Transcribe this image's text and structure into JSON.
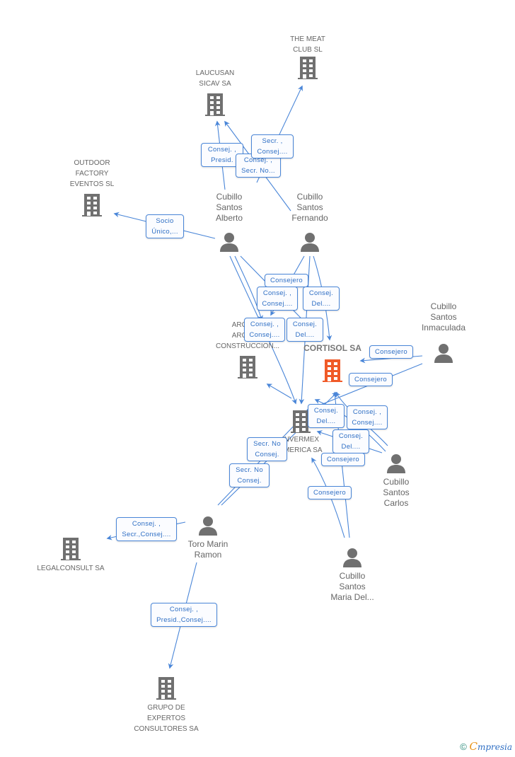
{
  "diagram": {
    "type": "corporate-relationship-graph",
    "colors": {
      "edge": "#4a86d8",
      "node_icon": "#707070",
      "main_icon": "#f05a28",
      "label_text": "#2f6fc4"
    },
    "nodes": [
      {
        "id": "the-meat-club",
        "kind": "company",
        "label": "THE MEAT\nCLUB SL"
      },
      {
        "id": "laucusan",
        "kind": "company",
        "label": "LAUCUSAN\nSICAV SA"
      },
      {
        "id": "outdoor-factory",
        "kind": "company",
        "label": "OUTDOOR\nFACTORY\nEVENTOS  SL"
      },
      {
        "id": "cubillo-alberto",
        "kind": "person",
        "label": "Cubillo\nSantos\nAlberto"
      },
      {
        "id": "cubillo-fernando",
        "kind": "person",
        "label": "Cubillo\nSantos\nFernando"
      },
      {
        "id": "arcadia",
        "kind": "company",
        "label": "ARCADIA\nARCADIA\nCONSTRUCCION..."
      },
      {
        "id": "cortisol",
        "kind": "main-company",
        "label": "CORTISOL SA"
      },
      {
        "id": "cubillo-inmaculada",
        "kind": "person",
        "label": "Cubillo\nSantos\nInmaculada"
      },
      {
        "id": "invermex",
        "kind": "company",
        "label": "INVERMEX\nAMERICA SA"
      },
      {
        "id": "cubillo-carlos",
        "kind": "person",
        "label": "Cubillo\nSantos\nCarlos"
      },
      {
        "id": "toro-marin",
        "kind": "person",
        "label": "Toro Marin\nRamon"
      },
      {
        "id": "legalconsult",
        "kind": "company",
        "label": "LEGALCONSULT SA"
      },
      {
        "id": "cubillo-maria",
        "kind": "person",
        "label": "Cubillo\nSantos\nMaria Del..."
      },
      {
        "id": "grupo-expertos",
        "kind": "company",
        "label": "GRUPO DE\nEXPERTOS\nCONSULTORES SA"
      }
    ],
    "edge_labels": [
      {
        "id": "e1",
        "text": "Secr. ,\nConsej...."
      },
      {
        "id": "e2",
        "text": "Consej. ,\nPresid."
      },
      {
        "id": "e3",
        "text": "Consej. ,\nSecr. No..."
      },
      {
        "id": "e4",
        "text": "Socio\nÚnico,..."
      },
      {
        "id": "e5",
        "text": "Consejero"
      },
      {
        "id": "e6",
        "text": "Consej. ,\nConsej...."
      },
      {
        "id": "e7",
        "text": "Consej.\nDel...."
      },
      {
        "id": "e8",
        "text": "Consej. ,\nConsej...."
      },
      {
        "id": "e9",
        "text": "Consej.\nDel...."
      },
      {
        "id": "e10",
        "text": "Consejero"
      },
      {
        "id": "e11",
        "text": "Consejero"
      },
      {
        "id": "e12",
        "text": "Consej.\nDel...."
      },
      {
        "id": "e13",
        "text": "Consej. ,\nConsej...."
      },
      {
        "id": "e14",
        "text": "Consej.\nDel...."
      },
      {
        "id": "e15",
        "text": "Secr.  No\nConsej."
      },
      {
        "id": "e16",
        "text": "Consejero"
      },
      {
        "id": "e17",
        "text": "Secr.  No\nConsej."
      },
      {
        "id": "e18",
        "text": "Consejero"
      },
      {
        "id": "e19",
        "text": "Consej. ,\nSecr.,Consej...."
      },
      {
        "id": "e20",
        "text": "Consej. ,\nPresid.,Consej...."
      }
    ]
  },
  "footer": {
    "copyright": "©",
    "brand_first": "C",
    "brand_rest": "mpresia"
  }
}
